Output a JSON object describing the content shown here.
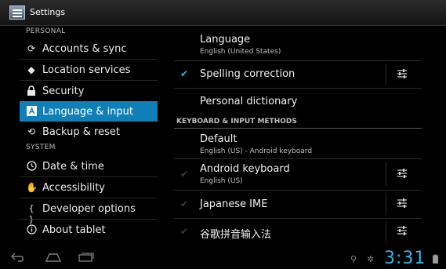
{
  "app": {
    "title": "Settings"
  },
  "sidebar": {
    "sections": [
      "PERSONAL",
      "SYSTEM"
    ],
    "items": [
      {
        "label": "Accounts & sync",
        "icon": "sync-icon"
      },
      {
        "label": "Location services",
        "icon": "location-icon"
      },
      {
        "label": "Security",
        "icon": "lock-icon"
      },
      {
        "label": "Language & input",
        "icon": "language-icon",
        "selected": true
      },
      {
        "label": "Backup & reset",
        "icon": "backup-icon"
      },
      {
        "label": "Date & time",
        "icon": "clock-icon"
      },
      {
        "label": "Accessibility",
        "icon": "hand-icon"
      },
      {
        "label": "Developer options",
        "icon": "braces-icon"
      },
      {
        "label": "About tablet",
        "icon": "info-icon"
      }
    ]
  },
  "content": {
    "language": {
      "title": "Language",
      "summary": "English (United States)"
    },
    "spelling": {
      "title": "Spelling correction",
      "checked": true
    },
    "dictionary": {
      "title": "Personal dictionary"
    },
    "category": "KEYBOARD & INPUT METHODS",
    "default_method": {
      "title": "Default",
      "summary": "English (US) - Android keyboard"
    },
    "methods": [
      {
        "title": "Android keyboard",
        "summary": "English (US)",
        "checked": true,
        "enabled": false
      },
      {
        "title": "Japanese IME",
        "summary": "",
        "checked": true,
        "enabled": false
      },
      {
        "title": "谷歌拼音输入法",
        "summary": "",
        "checked": true,
        "enabled": false
      }
    ]
  },
  "statusbar": {
    "time": "3:31"
  },
  "colors": {
    "accent": "#33b5e5",
    "selected_bg": "#0f7fb8"
  }
}
